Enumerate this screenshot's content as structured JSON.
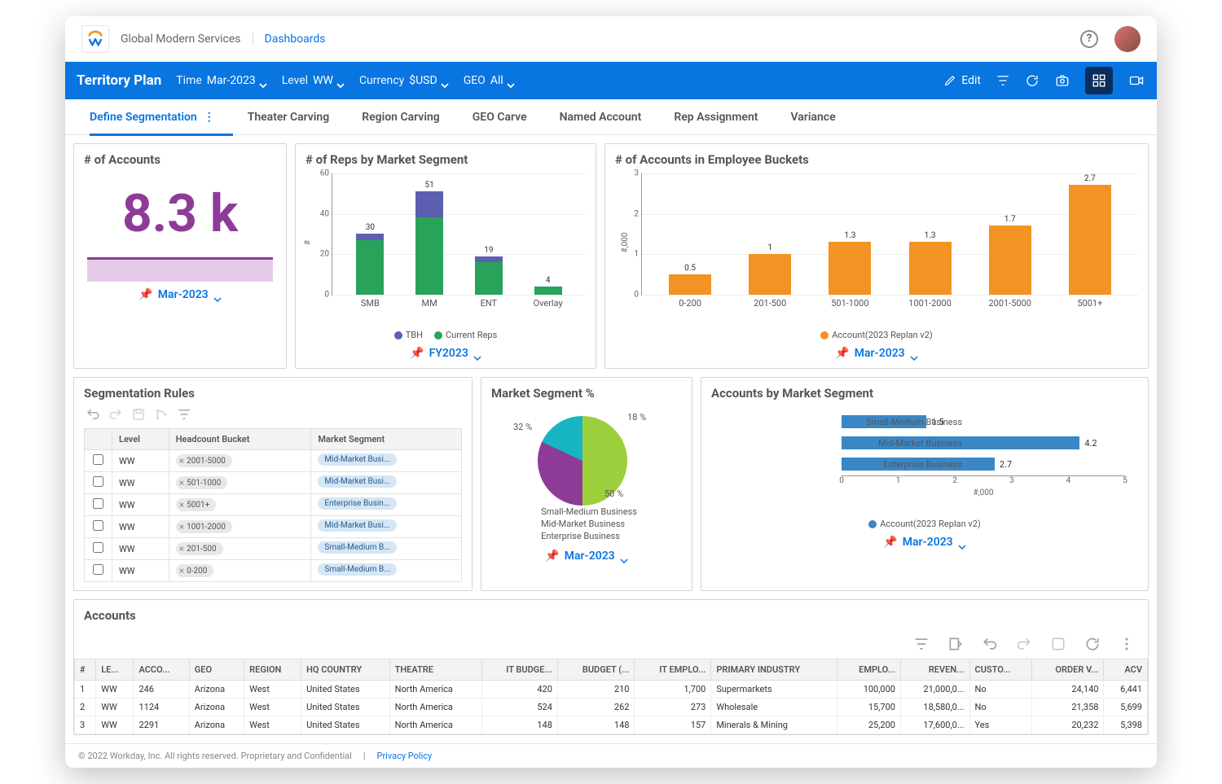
{
  "topbar": {
    "org": "Global Modern Services",
    "crumb": "Dashboards"
  },
  "bluebar": {
    "title": "Territory Plan",
    "filters": [
      {
        "label": "Time",
        "value": "Mar-2023"
      },
      {
        "label": "Level",
        "value": "WW"
      },
      {
        "label": "Currency",
        "value": "$USD"
      },
      {
        "label": "GEO",
        "value": "All"
      }
    ],
    "edit": "Edit"
  },
  "tabs": [
    "Define Segmentation",
    "Theater Carving",
    "Region Carving",
    "GEO Carve",
    "Named Account",
    "Rep Assignment",
    "Variance"
  ],
  "active_tab": 0,
  "kpi": {
    "title": "# of Accounts",
    "value": "8.3 k",
    "footer": "Mar-2023"
  },
  "reps_chart": {
    "title": "# of Reps by Market Segment",
    "footer": "FY2023",
    "legend": [
      "TBH",
      "Current Reps"
    ],
    "colors": {
      "TBH": "#5c5fb0",
      "Current Reps": "#29a35a"
    },
    "ylabel": "#"
  },
  "buckets_chart": {
    "title": "# of Accounts in Employee Buckets",
    "footer": "Mar-2023",
    "legend": "Account(2023 Replan v2)",
    "color": "#f39324",
    "ylabel": "#,000"
  },
  "seg_rules": {
    "title": "Segmentation Rules",
    "headers": [
      "",
      "Level",
      "Headcount Bucket",
      "Market Segment"
    ],
    "rows": [
      {
        "level": "WW",
        "bucket": "2001-5000",
        "segment": "Mid-Market Busi..."
      },
      {
        "level": "WW",
        "bucket": "501-1000",
        "segment": "Mid-Market Busi..."
      },
      {
        "level": "WW",
        "bucket": "5001+",
        "segment": "Enterprise Busin..."
      },
      {
        "level": "WW",
        "bucket": "1001-2000",
        "segment": "Mid-Market Busi..."
      },
      {
        "level": "WW",
        "bucket": "201-500",
        "segment": "Small-Medium B..."
      },
      {
        "level": "WW",
        "bucket": "0-200",
        "segment": "Small-Medium B..."
      }
    ]
  },
  "pie_chart": {
    "title": "Market Segment %",
    "footer": "Mar-2023",
    "colors": {
      "Small-Medium Business": "#17b4c4",
      "Mid-Market Business": "#9ccf3c",
      "Enterprise Business": "#8e3b97"
    }
  },
  "hbar_chart": {
    "title": "Accounts by Market Segment",
    "footer": "Mar-2023",
    "legend": "Account(2023 Replan v2)",
    "color": "#3a87c7",
    "xlabel": "#,000"
  },
  "accounts": {
    "title": "Accounts",
    "headers": [
      "#",
      "LE...",
      "ACCO...",
      "GEO",
      "REGION",
      "HQ COUNTRY",
      "THEATRE",
      "IT BUDGE...",
      "BUDGET (...",
      "IT EMPLO...",
      "PRIMARY INDUSTRY",
      "EMPLO...",
      "REVEN...",
      "CUSTO...",
      "ORDER V...",
      "ACV"
    ],
    "rows": [
      {
        "n": "1",
        "le": "WW",
        "acct": "246",
        "geo": "Arizona",
        "region": "West",
        "country": "United States",
        "theatre": "North America",
        "itb": "420",
        "budget": "210",
        "ite": "1,700",
        "ind": "Supermarkets",
        "emp": "100,000",
        "rev": "21,000,0...",
        "cust": "No",
        "ord": "24,140",
        "acv": "6,441"
      },
      {
        "n": "2",
        "le": "WW",
        "acct": "1124",
        "geo": "Arizona",
        "region": "West",
        "country": "United States",
        "theatre": "North America",
        "itb": "524",
        "budget": "262",
        "ite": "273",
        "ind": "Wholesale",
        "emp": "15,700",
        "rev": "18,580,0...",
        "cust": "No",
        "ord": "21,358",
        "acv": "5,699"
      },
      {
        "n": "3",
        "le": "WW",
        "acct": "2291",
        "geo": "Arizona",
        "region": "West",
        "country": "United States",
        "theatre": "North America",
        "itb": "148",
        "budget": "148",
        "ite": "157",
        "ind": "Minerals & Mining",
        "emp": "25,200",
        "rev": "17,600,0...",
        "cust": "Yes",
        "ord": "20,232",
        "acv": "5,398"
      }
    ]
  },
  "footer": {
    "copy": "© 2022 Workday, Inc. All rights reserved. Proprietary and Confidential",
    "privacy": "Privacy Policy"
  },
  "chart_data": [
    {
      "id": "reps_by_segment",
      "type": "bar",
      "stacked": true,
      "categories": [
        "SMB",
        "MM",
        "ENT",
        "Overlay"
      ],
      "series": [
        {
          "name": "Current Reps",
          "values": [
            27,
            38,
            16,
            4
          ]
        },
        {
          "name": "TBH",
          "values": [
            3,
            13,
            3,
            0
          ]
        }
      ],
      "totals": [
        30,
        51,
        19,
        4
      ],
      "ylim": [
        0,
        60
      ],
      "yticks": [
        0,
        20,
        40,
        60
      ],
      "ylabel": "#",
      "title": "# of Reps by Market Segment"
    },
    {
      "id": "accounts_in_buckets",
      "type": "bar",
      "categories": [
        "0-200",
        "201-500",
        "501-1000",
        "1001-2000",
        "2001-5000",
        "5001+"
      ],
      "values": [
        0.5,
        1.0,
        1.3,
        1.3,
        1.7,
        2.7
      ],
      "ylim": [
        0,
        3
      ],
      "yticks": [
        0,
        1,
        2,
        3
      ],
      "ylabel": "#,000",
      "title": "# of Accounts in Employee Buckets",
      "series_name": "Account(2023 Replan v2)"
    },
    {
      "id": "market_segment_pct",
      "type": "pie",
      "slices": [
        {
          "name": "Small-Medium Business",
          "value": 18
        },
        {
          "name": "Mid-Market Business",
          "value": 50
        },
        {
          "name": "Enterprise Business",
          "value": 32
        }
      ],
      "title": "Market Segment %"
    },
    {
      "id": "accounts_by_segment",
      "type": "bar",
      "orientation": "horizontal",
      "categories": [
        "Small-Medium Business",
        "Mid-Market Business",
        "Enterprise Business"
      ],
      "values": [
        1.5,
        4.2,
        2.7
      ],
      "xlim": [
        0,
        5
      ],
      "xticks": [
        0,
        1,
        2,
        3,
        4,
        5
      ],
      "xlabel": "#,000",
      "title": "Accounts by Market Segment",
      "series_name": "Account(2023 Replan v2)"
    }
  ]
}
